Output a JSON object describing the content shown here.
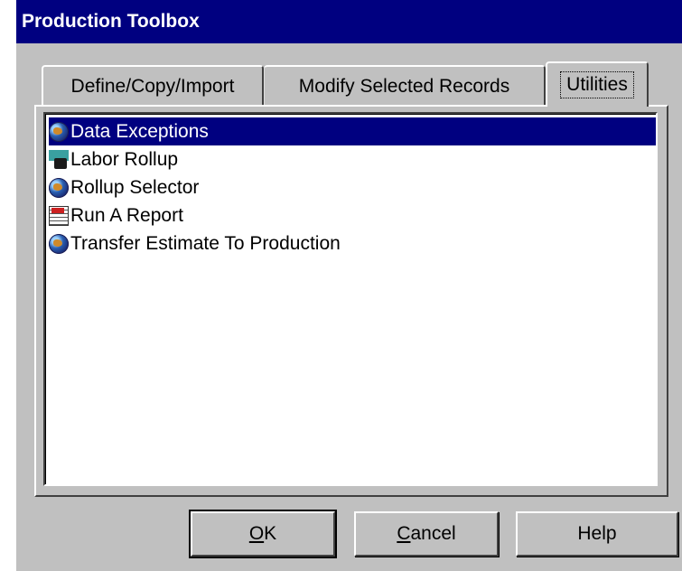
{
  "window": {
    "title": "Production Toolbox"
  },
  "tabs": [
    {
      "label": "Define/Copy/Import",
      "active": false
    },
    {
      "label": "Modify Selected Records",
      "active": false
    },
    {
      "label": "Utilities",
      "active": true
    }
  ],
  "list": {
    "items": [
      {
        "label": "Data Exceptions",
        "icon": "globe-icon",
        "selected": true
      },
      {
        "label": "Labor Rollup",
        "icon": "labor-icon",
        "selected": false
      },
      {
        "label": "Rollup Selector",
        "icon": "globe-icon",
        "selected": false
      },
      {
        "label": "Run A Report",
        "icon": "report-icon",
        "selected": false
      },
      {
        "label": "Transfer Estimate To Production",
        "icon": "globe-icon",
        "selected": false
      }
    ]
  },
  "buttons": {
    "ok": {
      "mnemonic": "O",
      "rest": "K"
    },
    "cancel": {
      "mnemonic": "C",
      "rest": "ancel"
    },
    "help": {
      "label": "Help"
    }
  },
  "colors": {
    "titlebar": "#000080",
    "face": "#c0c0c0",
    "selection": "#000080"
  }
}
